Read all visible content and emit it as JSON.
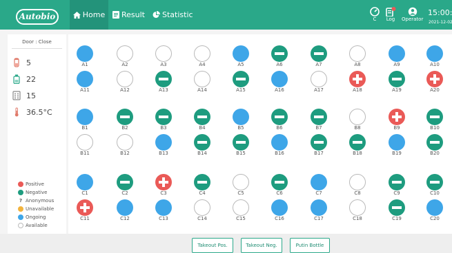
{
  "header": {
    "logo": "Autobio",
    "nav": {
      "home": "Home",
      "result": "Result",
      "statistic": "Statistic"
    },
    "c_label": "C",
    "log_label": "Log",
    "operator_label": "Operator",
    "time": "15:00:15",
    "date": "2021-12-02"
  },
  "sidebar": {
    "door": "Door : Close",
    "consumables": [
      {
        "icon": "tube-icon",
        "value": "5"
      },
      {
        "icon": "bottle-icon",
        "value": "22"
      },
      {
        "icon": "rack-icon",
        "value": "15"
      },
      {
        "icon": "thermometer-icon",
        "value": "36.5°C"
      }
    ],
    "legend": [
      {
        "status": "positive",
        "label": "Positive"
      },
      {
        "status": "negative",
        "label": "Negative"
      },
      {
        "status": "anonymous",
        "label": "Anonymous",
        "glyph": "?"
      },
      {
        "status": "unavailable",
        "label": "Unavailable"
      },
      {
        "status": "ongoing",
        "label": "Ongoing"
      },
      {
        "status": "available",
        "label": "Available"
      }
    ]
  },
  "wells": {
    "A": [
      "ongoing",
      "available",
      "available",
      "available",
      "ongoing",
      "negative",
      "negative",
      "available",
      "ongoing",
      "ongoing",
      "ongoing",
      "available",
      "negative",
      "available",
      "negative",
      "ongoing",
      "available",
      "positive",
      "negative",
      "positive"
    ],
    "B": [
      "ongoing",
      "negative",
      "negative",
      "negative",
      "ongoing",
      "negative",
      "negative",
      "available",
      "positive",
      "negative",
      "available",
      "available",
      "ongoing",
      "negative",
      "negative",
      "ongoing",
      "negative",
      "negative",
      "ongoing",
      "negative"
    ],
    "C": [
      "ongoing",
      "negative",
      "positive",
      "negative",
      "available",
      "negative",
      "ongoing",
      "available",
      "negative",
      "negative",
      "positive",
      "ongoing",
      "ongoing",
      "available",
      "available",
      "ongoing",
      "ongoing",
      "available",
      "negative",
      "ongoing"
    ]
  },
  "actions": {
    "takeout_pos": "Takeout Pos.",
    "takeout_neg": "Takeout Neg.",
    "putin_bottle": "Putin Bottle"
  },
  "colors": {
    "brand": "#2aa889",
    "ongoing": "#3ea6e8",
    "negative": "#1e9c7f",
    "positive": "#ea5a57",
    "unavailable": "#f2b33d"
  }
}
